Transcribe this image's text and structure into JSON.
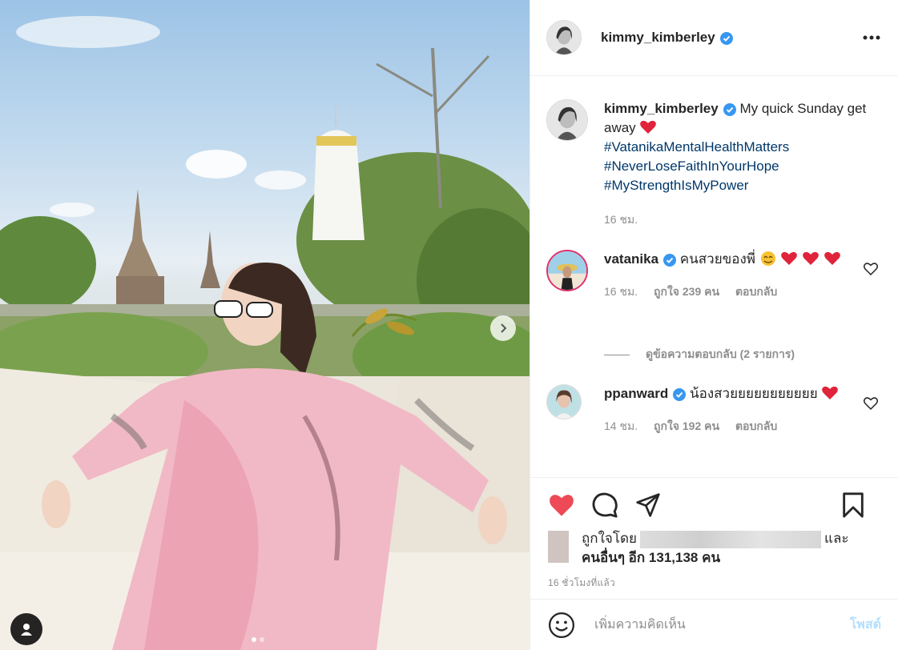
{
  "post": {
    "username": "kimmy_kimberley",
    "caption_text": "My quick Sunday get away",
    "hashtags": [
      "#VatanikaMentalHealthMatters",
      "#NeverLoseFaithInYourHope",
      "#MyStrengthIsMyPower"
    ],
    "caption_time": "16 ชม."
  },
  "comments": [
    {
      "username": "vatanika",
      "text": "คนสวยของพี่",
      "time": "16 ชม.",
      "likes": "ถูกใจ 239 คน",
      "reply": "ตอบกลับ"
    },
    {
      "username": "ppanward",
      "text": "น้องสวยยยยยยยยยยย",
      "time": "14 ชม.",
      "likes": "ถูกใจ 192 คน",
      "reply": "ตอบกลับ"
    }
  ],
  "view_replies": "ดูข้อความตอบกลับ (2 รายการ)",
  "likes_summary": {
    "prefix": "ถูกใจโดย",
    "suffix": "และ",
    "others": "คนอื่นๆ อีก 131,138 คน"
  },
  "posted_ago": "16 ชั่วโมงที่แล้ว",
  "add_comment": {
    "placeholder": "เพิ่มความคิดเห็น",
    "post_label": "โพสต์"
  },
  "colors": {
    "like_red": "#ed4956",
    "verified_blue": "#3897f0",
    "hashtag": "#00376b",
    "muted": "#8e8e8e"
  },
  "icons": [
    "more-icon",
    "heart-icon",
    "comment-icon",
    "share-icon",
    "save-icon",
    "emoji-icon",
    "next-arrow-icon",
    "user-tag-icon",
    "verified-icon"
  ]
}
